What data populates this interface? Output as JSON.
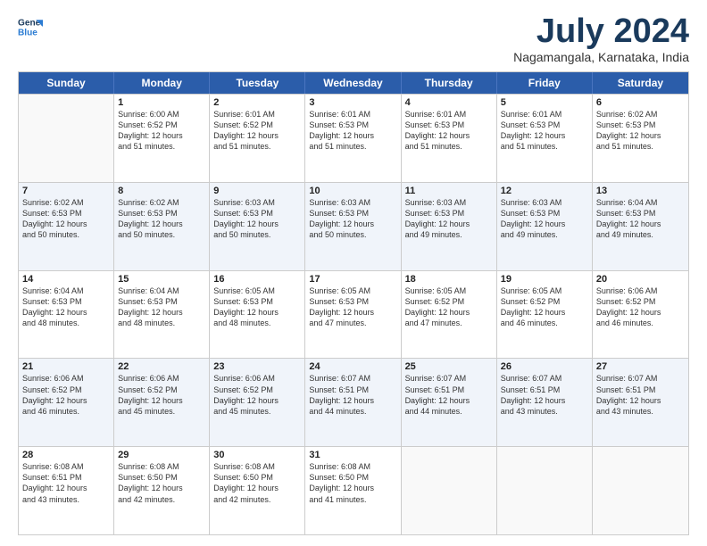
{
  "header": {
    "logo_line1": "General",
    "logo_line2": "Blue",
    "month": "July 2024",
    "location": "Nagamangala, Karnataka, India"
  },
  "weekdays": [
    "Sunday",
    "Monday",
    "Tuesday",
    "Wednesday",
    "Thursday",
    "Friday",
    "Saturday"
  ],
  "weeks": [
    [
      {
        "day": "",
        "text": ""
      },
      {
        "day": "1",
        "text": "Sunrise: 6:00 AM\nSunset: 6:52 PM\nDaylight: 12 hours\nand 51 minutes."
      },
      {
        "day": "2",
        "text": "Sunrise: 6:01 AM\nSunset: 6:52 PM\nDaylight: 12 hours\nand 51 minutes."
      },
      {
        "day": "3",
        "text": "Sunrise: 6:01 AM\nSunset: 6:53 PM\nDaylight: 12 hours\nand 51 minutes."
      },
      {
        "day": "4",
        "text": "Sunrise: 6:01 AM\nSunset: 6:53 PM\nDaylight: 12 hours\nand 51 minutes."
      },
      {
        "day": "5",
        "text": "Sunrise: 6:01 AM\nSunset: 6:53 PM\nDaylight: 12 hours\nand 51 minutes."
      },
      {
        "day": "6",
        "text": "Sunrise: 6:02 AM\nSunset: 6:53 PM\nDaylight: 12 hours\nand 51 minutes."
      }
    ],
    [
      {
        "day": "7",
        "text": "Sunrise: 6:02 AM\nSunset: 6:53 PM\nDaylight: 12 hours\nand 50 minutes."
      },
      {
        "day": "8",
        "text": "Sunrise: 6:02 AM\nSunset: 6:53 PM\nDaylight: 12 hours\nand 50 minutes."
      },
      {
        "day": "9",
        "text": "Sunrise: 6:03 AM\nSunset: 6:53 PM\nDaylight: 12 hours\nand 50 minutes."
      },
      {
        "day": "10",
        "text": "Sunrise: 6:03 AM\nSunset: 6:53 PM\nDaylight: 12 hours\nand 50 minutes."
      },
      {
        "day": "11",
        "text": "Sunrise: 6:03 AM\nSunset: 6:53 PM\nDaylight: 12 hours\nand 49 minutes."
      },
      {
        "day": "12",
        "text": "Sunrise: 6:03 AM\nSunset: 6:53 PM\nDaylight: 12 hours\nand 49 minutes."
      },
      {
        "day": "13",
        "text": "Sunrise: 6:04 AM\nSunset: 6:53 PM\nDaylight: 12 hours\nand 49 minutes."
      }
    ],
    [
      {
        "day": "14",
        "text": "Sunrise: 6:04 AM\nSunset: 6:53 PM\nDaylight: 12 hours\nand 48 minutes."
      },
      {
        "day": "15",
        "text": "Sunrise: 6:04 AM\nSunset: 6:53 PM\nDaylight: 12 hours\nand 48 minutes."
      },
      {
        "day": "16",
        "text": "Sunrise: 6:05 AM\nSunset: 6:53 PM\nDaylight: 12 hours\nand 48 minutes."
      },
      {
        "day": "17",
        "text": "Sunrise: 6:05 AM\nSunset: 6:53 PM\nDaylight: 12 hours\nand 47 minutes."
      },
      {
        "day": "18",
        "text": "Sunrise: 6:05 AM\nSunset: 6:52 PM\nDaylight: 12 hours\nand 47 minutes."
      },
      {
        "day": "19",
        "text": "Sunrise: 6:05 AM\nSunset: 6:52 PM\nDaylight: 12 hours\nand 46 minutes."
      },
      {
        "day": "20",
        "text": "Sunrise: 6:06 AM\nSunset: 6:52 PM\nDaylight: 12 hours\nand 46 minutes."
      }
    ],
    [
      {
        "day": "21",
        "text": "Sunrise: 6:06 AM\nSunset: 6:52 PM\nDaylight: 12 hours\nand 46 minutes."
      },
      {
        "day": "22",
        "text": "Sunrise: 6:06 AM\nSunset: 6:52 PM\nDaylight: 12 hours\nand 45 minutes."
      },
      {
        "day": "23",
        "text": "Sunrise: 6:06 AM\nSunset: 6:52 PM\nDaylight: 12 hours\nand 45 minutes."
      },
      {
        "day": "24",
        "text": "Sunrise: 6:07 AM\nSunset: 6:51 PM\nDaylight: 12 hours\nand 44 minutes."
      },
      {
        "day": "25",
        "text": "Sunrise: 6:07 AM\nSunset: 6:51 PM\nDaylight: 12 hours\nand 44 minutes."
      },
      {
        "day": "26",
        "text": "Sunrise: 6:07 AM\nSunset: 6:51 PM\nDaylight: 12 hours\nand 43 minutes."
      },
      {
        "day": "27",
        "text": "Sunrise: 6:07 AM\nSunset: 6:51 PM\nDaylight: 12 hours\nand 43 minutes."
      }
    ],
    [
      {
        "day": "28",
        "text": "Sunrise: 6:08 AM\nSunset: 6:51 PM\nDaylight: 12 hours\nand 43 minutes."
      },
      {
        "day": "29",
        "text": "Sunrise: 6:08 AM\nSunset: 6:50 PM\nDaylight: 12 hours\nand 42 minutes."
      },
      {
        "day": "30",
        "text": "Sunrise: 6:08 AM\nSunset: 6:50 PM\nDaylight: 12 hours\nand 42 minutes."
      },
      {
        "day": "31",
        "text": "Sunrise: 6:08 AM\nSunset: 6:50 PM\nDaylight: 12 hours\nand 41 minutes."
      },
      {
        "day": "",
        "text": ""
      },
      {
        "day": "",
        "text": ""
      },
      {
        "day": "",
        "text": ""
      }
    ]
  ]
}
